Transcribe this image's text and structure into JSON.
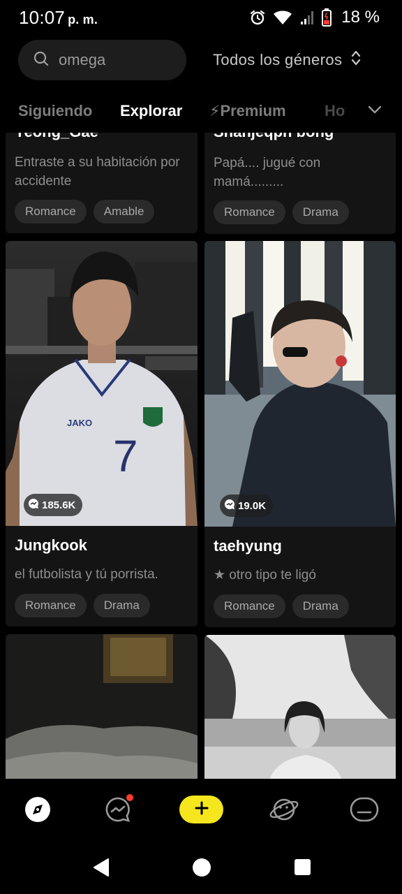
{
  "status_bar": {
    "time": "10:07",
    "ampm": "p. m.",
    "battery_percent": "18 %",
    "icons": [
      "alarm-icon",
      "wifi-icon",
      "signal-icon",
      "battery-icon"
    ]
  },
  "search": {
    "placeholder": "omega",
    "value": ""
  },
  "genre_filter": {
    "selected": "Todos los géneros"
  },
  "tabs": [
    {
      "label": "Siguiendo",
      "active": false
    },
    {
      "label": "Explorar",
      "active": true
    },
    {
      "label": "⚡Premium",
      "active": false
    },
    {
      "label": "Hot",
      "active": false
    }
  ],
  "cards": [
    {
      "title": "Yeong_Gae",
      "desc": "Entraste a su habitación por accidente",
      "tags": [
        "Romance",
        "Amable"
      ]
    },
    {
      "title": "Shanjeqph bong",
      "desc": "Papá.... jugué con mamá.........",
      "tags": [
        "Romance",
        "Drama"
      ]
    },
    {
      "title": "Jungkook",
      "desc": "el futbolista y tú porrista.",
      "count": "185.6K",
      "tags": [
        "Romance",
        "Drama"
      ]
    },
    {
      "title": "taehyung",
      "desc": "★ otro tipo te ligó",
      "count": "19.0K",
      "tags": [
        "Romance",
        "Drama"
      ]
    }
  ],
  "bottom_nav": {
    "items": [
      "explore-icon",
      "chat-icon",
      "create-icon",
      "planet-icon",
      "profile-icon"
    ],
    "create_label": "+"
  },
  "colors": {
    "accent_yellow": "#f5e61d",
    "notification_red": "#ff3b30",
    "card_bg": "#141414",
    "tag_bg": "#2a2a2a"
  }
}
